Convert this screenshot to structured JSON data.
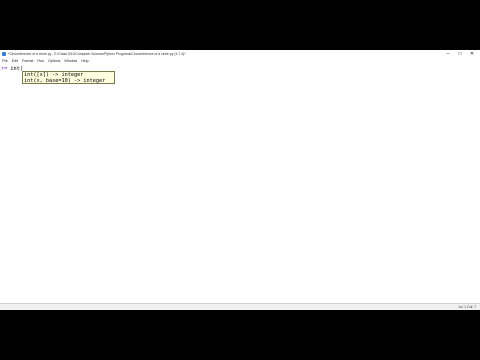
{
  "window": {
    "title": "*Circumference of a circle.py - E:/Class 9/10/Computer Science/Python Programs/Circumference of a circle.py (3.7.4)*",
    "controls": {
      "minimize": "–",
      "maximize": "□",
      "close": "✕"
    },
    "title_icon": "python-file-icon"
  },
  "menubar": {
    "items": [
      {
        "label": "File"
      },
      {
        "label": "Edit"
      },
      {
        "label": "Format"
      },
      {
        "label": "Run"
      },
      {
        "label": "Options"
      },
      {
        "label": "Window"
      },
      {
        "label": "Help"
      }
    ]
  },
  "editor": {
    "line1": {
      "prompt": "r=",
      "code": " int("
    }
  },
  "calltip": {
    "line1": "int([x]) -> integer",
    "line2": "int(x, base=10) -> integer"
  },
  "statusbar": {
    "position": "Ln: 1   Col: 7"
  }
}
